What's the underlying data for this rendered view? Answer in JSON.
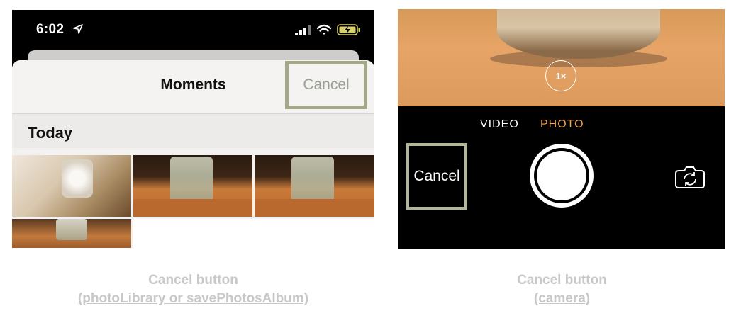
{
  "status_bar": {
    "time": "6:02"
  },
  "picker": {
    "title": "Moments",
    "cancel_label": "Cancel",
    "section_label": "Today"
  },
  "camera": {
    "zoom_label": "1×",
    "modes": [
      "VIDEO",
      "PHOTO"
    ],
    "active_mode": "PHOTO",
    "cancel_label": "Cancel"
  },
  "captions": {
    "left": [
      "Cancel button",
      "(photoLibrary or savePhotosAlbum)"
    ],
    "right": [
      "Cancel button",
      "(camera)"
    ]
  },
  "colors": {
    "highlight_box": "#a3a888",
    "active_mode": "#f2a84a",
    "caption": "#c8c8c8"
  },
  "icons": [
    "location-arrow-icon",
    "cellular-signal-icon",
    "wifi-icon",
    "battery-charging-icon",
    "camera-flip-icon"
  ]
}
